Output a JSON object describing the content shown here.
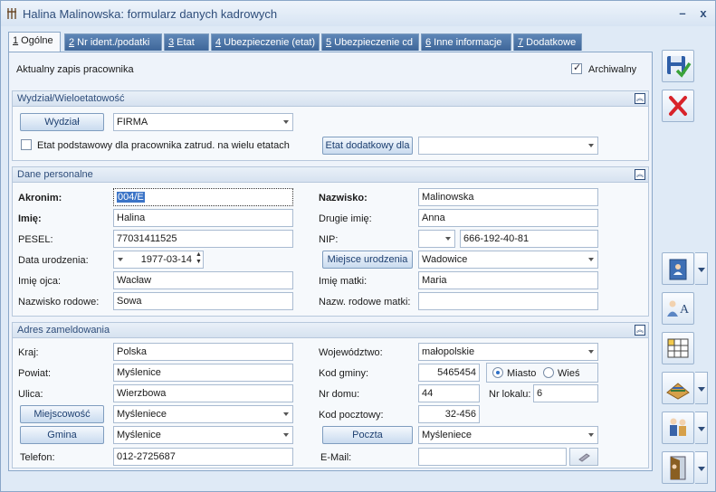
{
  "window": {
    "title": "Halina Malinowska: formularz danych kadrowych",
    "minimize": "–",
    "close": "x"
  },
  "tabs": [
    {
      "key": "1",
      "label": " Ogólne"
    },
    {
      "key": "2",
      "label": " Nr ident./podatki"
    },
    {
      "key": "3",
      "label": " Etat"
    },
    {
      "key": "4",
      "label": " Ubezpieczenie (etat)"
    },
    {
      "key": "5",
      "label": " Ubezpieczenie cd"
    },
    {
      "key": "6",
      "label": " Inne informacje"
    },
    {
      "key": "7",
      "label": " Dodatkowe"
    }
  ],
  "header": {
    "current_record": "Aktualny zapis pracownika",
    "archived_label": "Archiwalny",
    "archived_checked": true
  },
  "wydzial": {
    "title": "Wydział/Wieloetatowość",
    "wydzial_button": "Wydział",
    "wydzial_value": "FIRMA",
    "etat_checkbox_label": "Etat podstawowy dla pracownika zatrud. na wielu etatach",
    "etat_dodatkowy_button": "Etat dodatkowy dla",
    "etat_dodatkowy_value": ""
  },
  "personal": {
    "title": "Dane personalne",
    "akronim_label": "Akronim:",
    "akronim_value": "004/E",
    "nazwisko_label": "Nazwisko:",
    "nazwisko_value": "Malinowska",
    "imie_label": "Imię:",
    "imie_value": "Halina",
    "drugie_imie_label": "Drugie imię:",
    "drugie_imie_value": "Anna",
    "pesel_label": "PESEL:",
    "pesel_value": "77031411525",
    "nip_label": "NIP:",
    "nip_prefix": "",
    "nip_value": "666-192-40-81",
    "data_ur_label": "Data urodzenia:",
    "data_ur_value": "1977-03-14",
    "miejsce_ur_button": "Miejsce urodzenia",
    "miejsce_ur_value": "Wadowice",
    "imie_ojca_label": "Imię ojca:",
    "imie_ojca_value": "Wacław",
    "imie_matki_label": "Imię matki:",
    "imie_matki_value": "Maria",
    "nazwisko_rodowe_label": "Nazwisko rodowe:",
    "nazwisko_rodowe_value": "Sowa",
    "nazw_rodowe_matki_label": "Nazw. rodowe matki:",
    "nazw_rodowe_matki_value": ""
  },
  "address": {
    "title": "Adres zameldowania",
    "kraj_label": "Kraj:",
    "kraj_value": "Polska",
    "wojewodztwo_label": "Województwo:",
    "wojewodztwo_value": "małopolskie",
    "powiat_label": "Powiat:",
    "powiat_value": "Myślenice",
    "kod_gminy_label": "Kod gminy:",
    "kod_gminy_value": "5465454",
    "miasto_label": "Miasto",
    "wies_label": "Wieś",
    "ulica_label": "Ulica:",
    "ulica_value": "Wierzbowa",
    "nr_domu_label": "Nr domu:",
    "nr_domu_value": "44",
    "nr_lokalu_label": "Nr lokalu:",
    "nr_lokalu_value": "6",
    "miejscowosc_button": "Miejscowość",
    "miejscowosc_value": "Myśleniece",
    "kod_pocztowy_label": "Kod pocztowy:",
    "kod_pocztowy_value": "32-456",
    "gmina_button": "Gmina",
    "gmina_value": "Myślenice",
    "poczta_button": "Poczta",
    "poczta_value": "Myśleniece",
    "telefon_label": "Telefon:",
    "telefon_value": "012-2725687",
    "email_label": "E-Mail:",
    "email_value": ""
  },
  "side_icons": [
    "save-icon",
    "cancel-icon",
    "employee-card-icon",
    "spelling-icon",
    "grid-icon",
    "schedule-icon",
    "people-icon",
    "exit-door-icon"
  ]
}
